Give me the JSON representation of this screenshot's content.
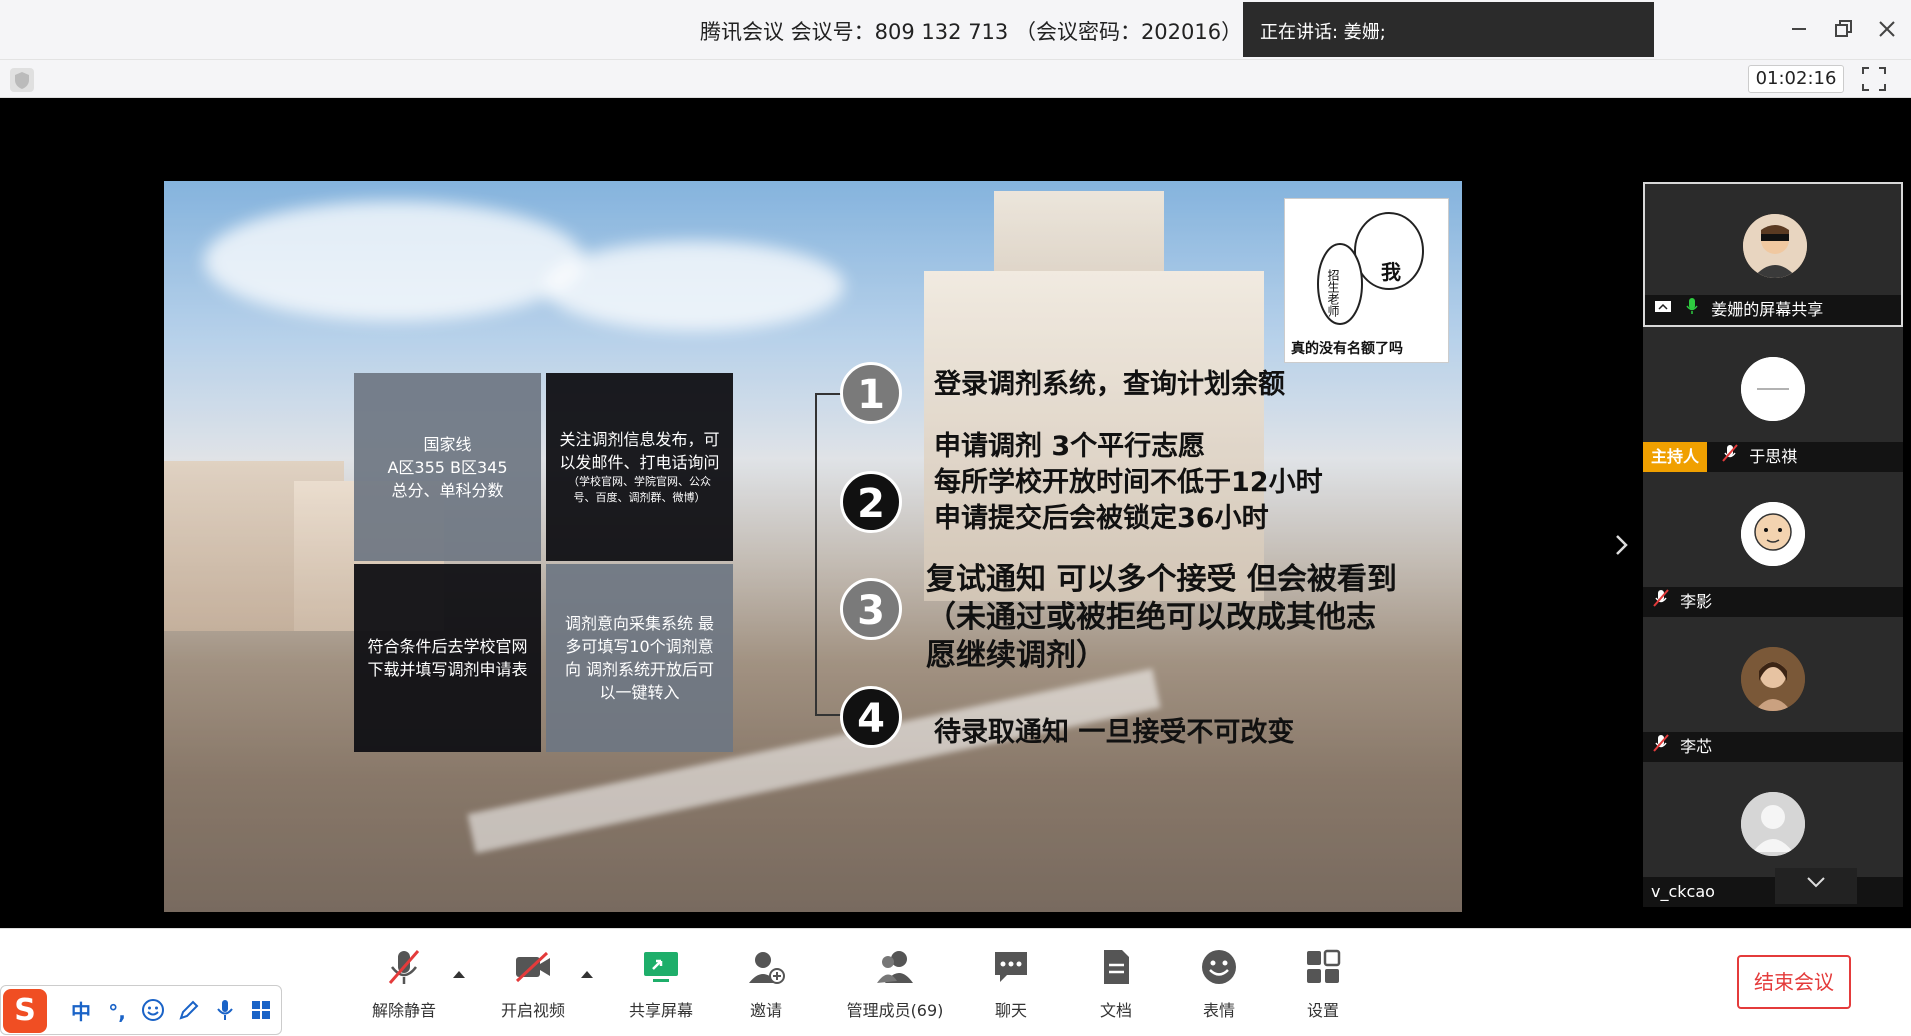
{
  "window": {
    "title": "腾讯会议 会议号：809 132 713 （会议密码：202016）",
    "speaking": "正在讲话: 姜姗;",
    "timer": "01:02:16"
  },
  "slide": {
    "boxes": [
      "国家线\nA区355 B区345\n总分、单科分数",
      "关注调剂信息发布，可以发邮件、打电话询问",
      "（学校官网、学院官网、公众号、百度、调剂群、微博）",
      "符合条件后去学校官网下载并填写调剂申请表",
      "调剂意向采集系统 最多可填写10个调剂意向 调剂系统开放后可以一键转入"
    ],
    "sticker_word": "我",
    "sticker_side": "招生老师",
    "sticker_caption": "真的没有名额了吗",
    "steps": [
      {
        "num": "1",
        "lines": [
          "登录调剂系统，查询计划余额"
        ]
      },
      {
        "num": "2",
        "lines": [
          "申请调剂 3个平行志愿",
          "每所学校开放时间不低于12小时",
          "申请提交后会被锁定36小时"
        ]
      },
      {
        "num": "3",
        "lines": [
          "复试通知 可以多个接受 但会被看到",
          "（未通过或被拒绝可以改成其他志",
          "愿继续调剂）"
        ]
      },
      {
        "num": "4",
        "lines": [
          "待录取通知 一旦接受不可改变"
        ]
      }
    ]
  },
  "participants": [
    {
      "name": "姜姗的屏幕共享",
      "icon": "screen-share-icon",
      "mic": "on"
    },
    {
      "name": "于思祺",
      "host_badge": "主持人",
      "mic": "muted"
    },
    {
      "name": "李影",
      "mic": "muted"
    },
    {
      "name": "李芯",
      "mic": "muted"
    },
    {
      "name": "v_ckcao",
      "mic": "none"
    }
  ],
  "toolbar": {
    "mute": "解除静音",
    "video": "开启视频",
    "share": "共享屏幕",
    "invite": "邀请",
    "members": "管理成员(69)",
    "chat": "聊天",
    "docs": "文档",
    "reactions": "表情",
    "settings": "设置",
    "end": "结束会议"
  },
  "ime": {
    "logo": "S",
    "mode": "中",
    "punct": "°,"
  }
}
